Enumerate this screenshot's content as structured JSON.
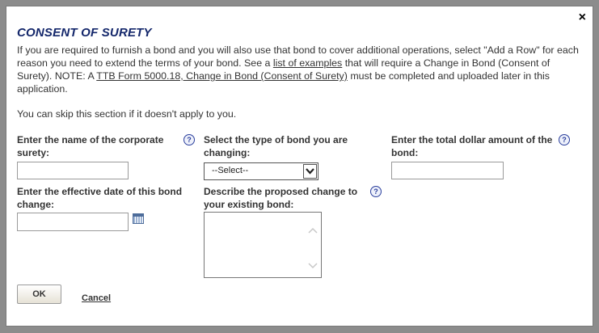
{
  "dialog": {
    "title": "CONSENT OF SURETY",
    "close_label": "×",
    "intro_part1": "If you are required to furnish a bond and you will also use that bond to cover additional operations, select \"Add a Row\" for each reason you need to extend the terms of your bond. See a ",
    "intro_link1": "list of examples",
    "intro_part2": " that will require a Change in Bond (Consent of Surety). NOTE: A ",
    "intro_link2": "TTB Form 5000.18, Change in Bond (Consent of Surety)",
    "intro_part3": " must be completed and uploaded later in this application.",
    "skip_text": "You can skip this section if it doesn't apply to you."
  },
  "form": {
    "surety_label": "Enter the name of the corporate surety:",
    "surety_value": "",
    "bond_type_label": "Select the type of bond you are changing:",
    "bond_type_selected": "--Select--",
    "amount_label": "Enter the total dollar amount of the bond:",
    "amount_value": "",
    "date_label": "Enter the effective date of this bond change:",
    "date_value": "",
    "change_label": "Describe the proposed change to your existing bond:",
    "change_value": "",
    "help_glyph": "?"
  },
  "actions": {
    "ok_label": "OK",
    "cancel_label": "Cancel"
  },
  "icons": {
    "close": "close-icon",
    "help": "help-icon",
    "calendar": "calendar-icon",
    "dropdown": "chevron-down-icon"
  },
  "colors": {
    "title": "#14276b",
    "help": "#2a3e9c",
    "overlay": "#8c8c8c"
  }
}
